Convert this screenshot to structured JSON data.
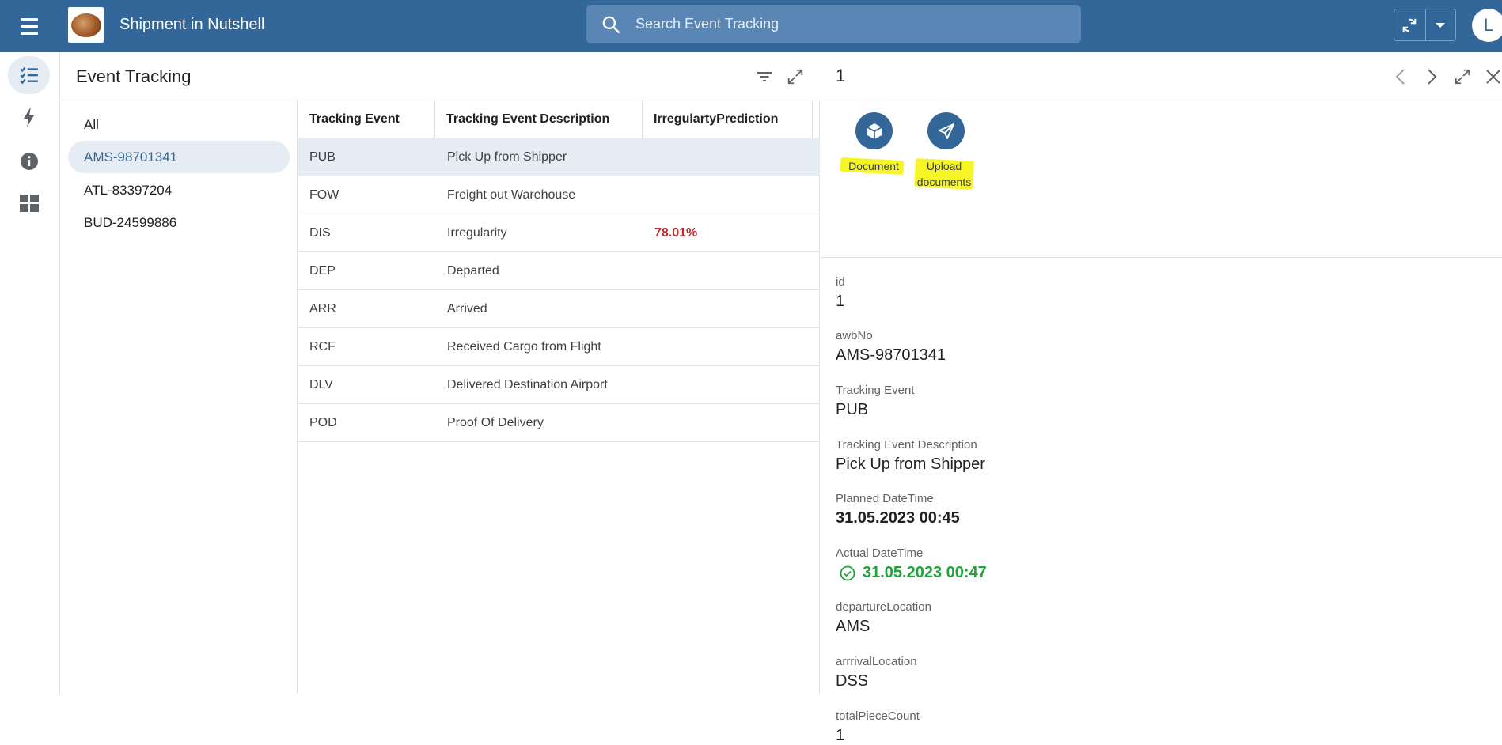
{
  "app": {
    "title": "Shipment in Nutshell",
    "search_placeholder": "Search Event Tracking",
    "user_initial": "L",
    "accent": "#336699"
  },
  "rail": {
    "items": [
      {
        "icon": "checklist-icon",
        "active": true
      },
      {
        "icon": "lightning-icon",
        "active": false
      },
      {
        "icon": "info-icon",
        "active": false
      },
      {
        "icon": "dashboard-icon",
        "active": false
      }
    ]
  },
  "list": {
    "title": "Event Tracking",
    "facets": [
      {
        "label": "All",
        "active": false
      },
      {
        "label": "AMS-98701341",
        "active": true
      },
      {
        "label": "ATL-83397204",
        "active": false
      },
      {
        "label": "BUD-24599886",
        "active": false
      }
    ],
    "columns": [
      "Tracking Event",
      "Tracking Event Description",
      "IrregulartyPrediction"
    ],
    "rows": [
      {
        "code": "PUB",
        "description": "Pick Up from Shipper",
        "prediction": "",
        "selected": true
      },
      {
        "code": "FOW",
        "description": "Freight out Warehouse",
        "prediction": ""
      },
      {
        "code": "DIS",
        "description": "Irregularity",
        "prediction": "78.01%"
      },
      {
        "code": "DEP",
        "description": "Departed",
        "prediction": ""
      },
      {
        "code": "ARR",
        "description": "Arrived",
        "prediction": ""
      },
      {
        "code": "RCF",
        "description": "Received Cargo from Flight",
        "prediction": ""
      },
      {
        "code": "DLV",
        "description": "Delivered Destination Airport",
        "prediction": ""
      },
      {
        "code": "POD",
        "description": "Proof Of Delivery",
        "prediction": ""
      }
    ]
  },
  "detail": {
    "title": "1",
    "actions": {
      "document": "Document",
      "upload_line1": "Upload",
      "upload_line2": "documents"
    },
    "fields": {
      "id": {
        "label": "id",
        "value": "1"
      },
      "awbNo": {
        "label": "awbNo",
        "value": "AMS-98701341"
      },
      "tracking_event": {
        "label": "Tracking Event",
        "value": "PUB"
      },
      "tracking_event_description": {
        "label": "Tracking Event Description",
        "value": "Pick Up from Shipper"
      },
      "planned_datetime": {
        "label": "Planned DateTime",
        "value": "31.05.2023 00:45"
      },
      "actual_datetime": {
        "label": "Actual DateTime",
        "value": "31.05.2023 00:47"
      },
      "departure_location": {
        "label": "departureLocation",
        "value": "AMS"
      },
      "arrival_location": {
        "label": "arrrivalLocation",
        "value": "DSS"
      },
      "total_piece_count": {
        "label": "totalPieceCount",
        "value": "1"
      }
    }
  }
}
